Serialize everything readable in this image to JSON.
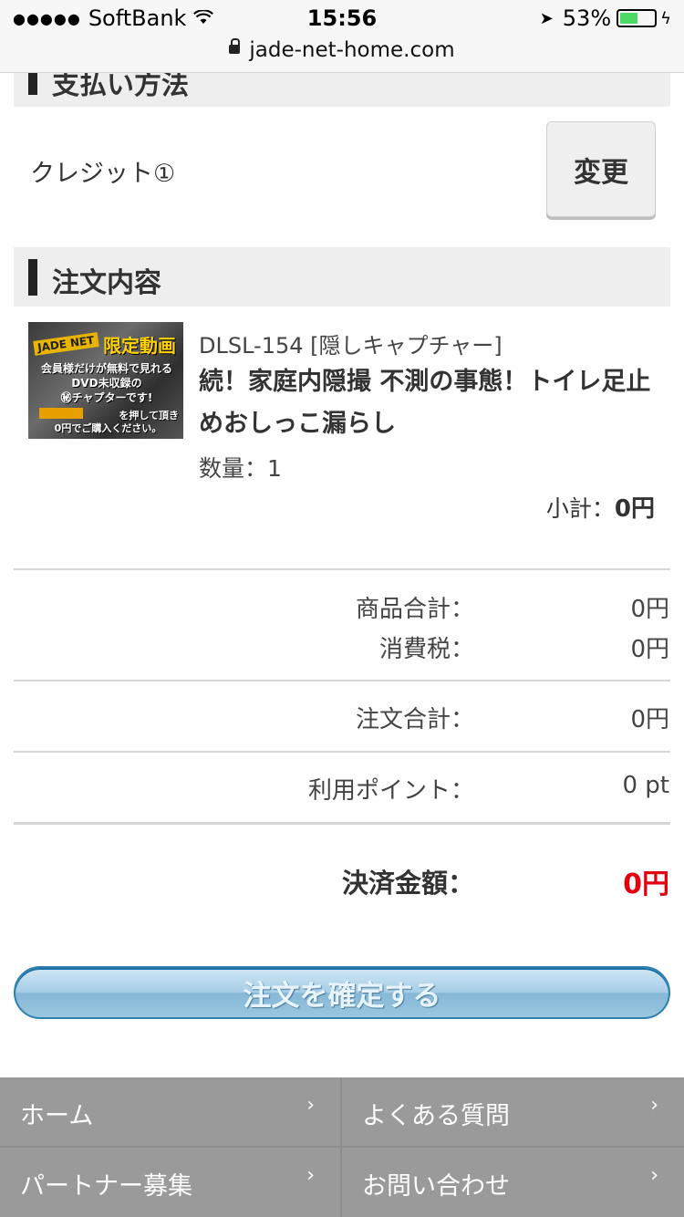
{
  "status_bar": {
    "carrier": "SoftBank",
    "time": "15:56",
    "battery_percent": "53%",
    "battery_level": 0.53
  },
  "browser": {
    "url": "jade-net-home.com"
  },
  "payment": {
    "section_title": "支払い方法",
    "method": "クレジット①",
    "change_label": "変更"
  },
  "order": {
    "section_title": "注文内容",
    "thumbnail": {
      "brand": "JADE NET",
      "headline": "限定動画",
      "lines": [
        "会員様だけが無料で見れる",
        "DVD未収録の",
        "㊙チャプターです!",
        "を押して頂き",
        "0円でご購入ください。"
      ],
      "chip": "カートへ"
    },
    "product_code": "DLSL-154 [隠しキャプチャー]",
    "product_title": "続！家庭内隠撮 不測の事態！トイレ足止めおしっこ漏らし",
    "quantity": "数量：1",
    "subtotal_label": "小計：",
    "subtotal_value": "0円"
  },
  "summary": {
    "goods_total_label": "商品合計：",
    "goods_total_value": "0円",
    "tax_label": "消費税：",
    "tax_value": "0円",
    "order_total_label": "注文合計：",
    "order_total_value": "0円",
    "points_label": "利用ポイント：",
    "points_value": "0 pt",
    "payment_amount_label": "決済金額：",
    "payment_amount_value": "0円",
    "payment_amount_color": "#e3000f"
  },
  "confirm_button": "注文を確定する",
  "footer": {
    "items": [
      {
        "label": "ホーム"
      },
      {
        "label": "よくある質問"
      },
      {
        "label": "パートナー募集"
      },
      {
        "label": "お問い合わせ"
      }
    ],
    "chevron": "›"
  }
}
